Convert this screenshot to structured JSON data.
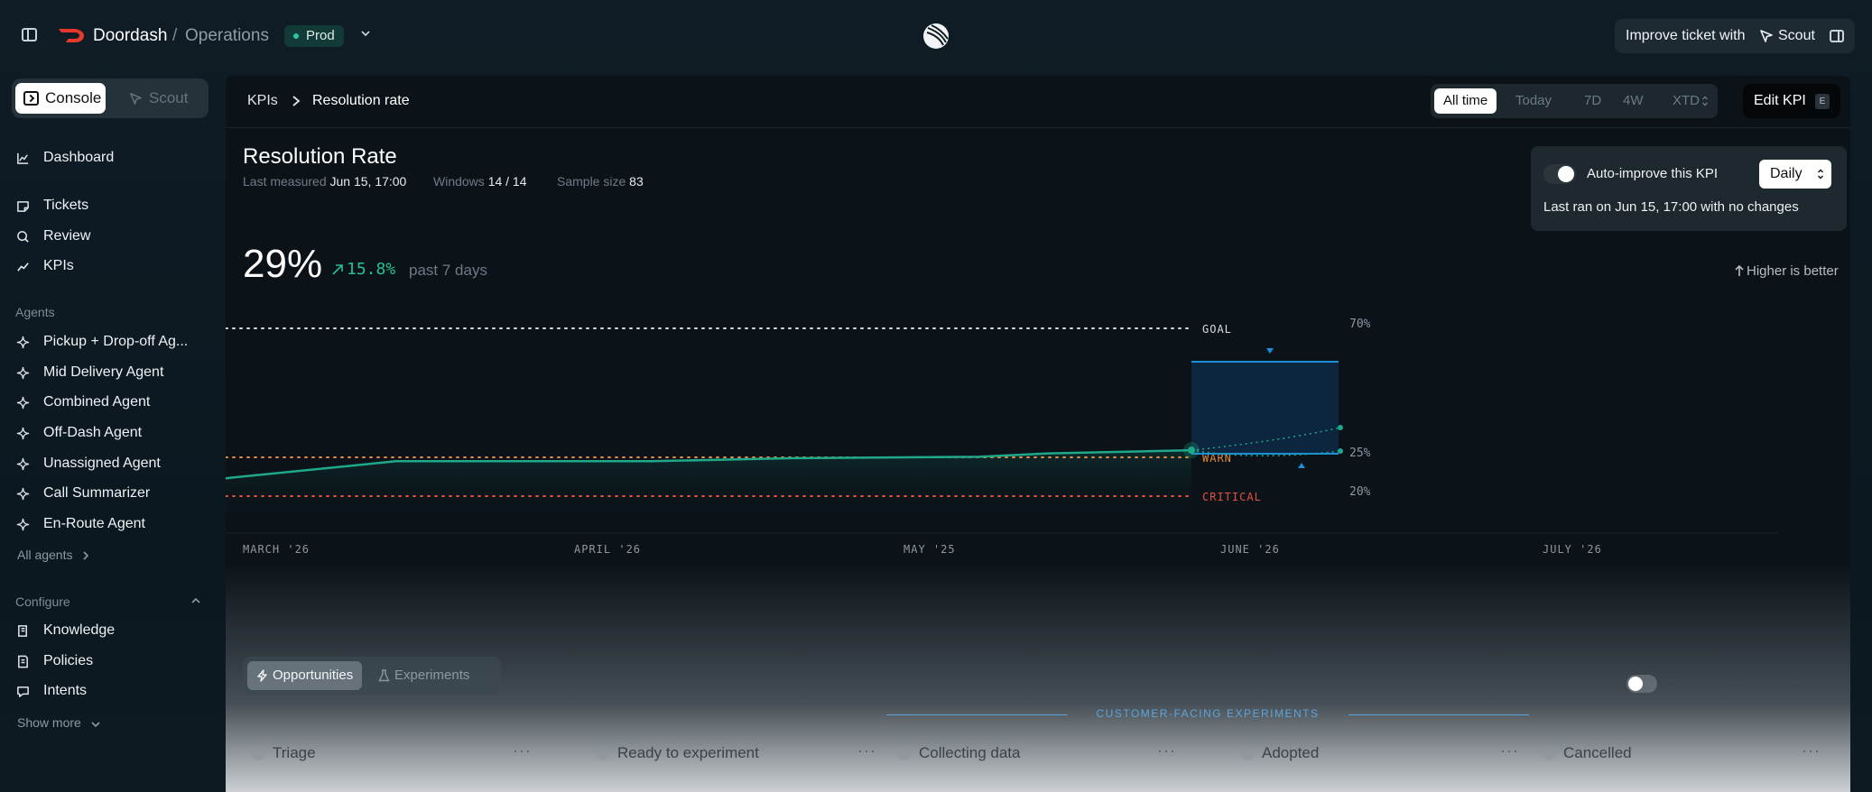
{
  "topbar": {
    "brand": "Doordash",
    "separator": "/",
    "org": "Operations",
    "env": "Prod",
    "improve_label": "Improve ticket with",
    "scout_label": "Scout"
  },
  "sidebar": {
    "console_label": "Console",
    "scout_label": "Scout",
    "nav": [
      "Dashboard",
      "Tickets",
      "Review",
      "KPIs"
    ],
    "agents_heading": "Agents",
    "agents": [
      "Pickup + Drop-off Ag...",
      "Mid Delivery Agent",
      "Combined Agent",
      "Off-Dash Agent",
      "Unassigned Agent",
      "Call Summarizer",
      "En-Route Agent"
    ],
    "all_agents": "All agents",
    "configure_heading": "Configure",
    "configure": [
      "Knowledge",
      "Policies",
      "Intents"
    ],
    "show_more": "Show more"
  },
  "breadcrumb": {
    "root": "KPIs",
    "current": "Resolution rate"
  },
  "range": {
    "options": [
      "All time",
      "Today",
      "7D",
      "4W",
      "XTD"
    ],
    "selected": "All time"
  },
  "edit_kpi": {
    "label": "Edit KPI",
    "shortcut": "E"
  },
  "kpi": {
    "title": "Resolution Rate",
    "last_measured_label": "Last measured",
    "last_measured": "Jun 15, 17:00",
    "windows_label": "Windows",
    "windows": "14 / 14",
    "sample_label": "Sample size",
    "sample": "83",
    "value": "29%",
    "delta": "15.8%",
    "delta_period": "past 7 days",
    "direction": "Higher is better"
  },
  "auto_improve": {
    "label": "Auto-improve this KPI",
    "enabled": true,
    "frequency": "Daily",
    "last_ran": "Last ran on Jun 15, 17:00 with no changes"
  },
  "chart_data": {
    "type": "line",
    "x": [
      "2026-02-24",
      "2026-03-20",
      "2026-04-25",
      "2026-05-15",
      "2026-06-10",
      "2026-06-20",
      "2026-07-10"
    ],
    "values": [
      22.3,
      24.5,
      24.5,
      24.9,
      25.2,
      26.4,
      27.5
    ],
    "thresholds": [
      {
        "label": "GOAL",
        "value": 70,
        "color": "#d7dde1"
      },
      {
        "label": "WARN",
        "value": 25,
        "color": "#e48a3a"
      },
      {
        "label": "CRITICAL",
        "value": 20,
        "color": "#e2513f"
      }
    ],
    "y_ticks": [
      "70%",
      "25%",
      "20%"
    ],
    "x_ticks": [
      "MARCH '26",
      "APRIL '26",
      "MAY '25",
      "JUNE '26",
      "JULY '26"
    ],
    "line_color": "#1fa88a",
    "forecast_color": "#1b8fd8"
  },
  "board": {
    "tabs": [
      "Opportunities",
      "Experiments"
    ],
    "active_tab": "Opportunities",
    "collapse_label": "Collapse empty columns",
    "group_label": "CUSTOMER-FACING EXPERIMENTS",
    "columns": [
      "Triage",
      "Ready to experiment",
      "Collecting data",
      "Adopted",
      "Cancelled"
    ]
  }
}
